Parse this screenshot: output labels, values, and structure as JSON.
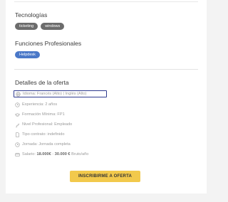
{
  "tecnologias": {
    "title": "Tecnologías",
    "tags": [
      "ticketing",
      "windows"
    ]
  },
  "funciones": {
    "title": "Funciones Profesionales",
    "tags": [
      "Helpdesk"
    ]
  },
  "detalles": {
    "title": "Detalles de la oferta",
    "idioma": "Idioma: Francés (Alto) | Inglés (Alto)",
    "experiencia": "Experiencia: 2 años",
    "formacion": "Formación Mínima: FP1",
    "nivel": "Nivel Profesional: Empleado",
    "tipo_contrato": "Tipo contrato: indefinido",
    "jornada": "Jornada: Jornada completa",
    "salario_prefix": "Salario:",
    "salario_min": "18.000€",
    "salario_sep": "-",
    "salario_max": "30.000 €",
    "salario_suffix": "Bruto/año"
  },
  "cta": {
    "label": "INSCRIBIRME A OFERTA"
  },
  "colors": {
    "accent": "#f2c94c",
    "tag_dark": "#6c6c6c",
    "tag_blue": "#4a78c8",
    "highlight_border": "#2f3b8f"
  },
  "icons": [
    "globe-icon",
    "clock-icon",
    "graduation-cap-icon",
    "ladder-icon",
    "document-icon",
    "clock-icon",
    "wallet-icon"
  ]
}
